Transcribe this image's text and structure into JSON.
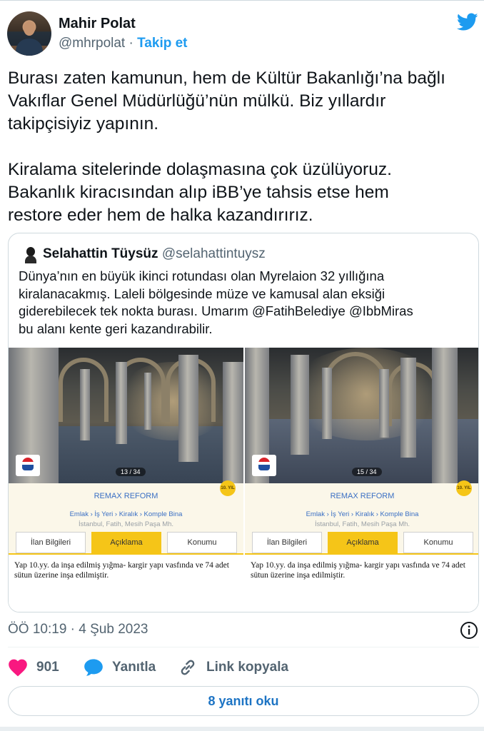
{
  "author": {
    "name": "Mahir Polat",
    "handle": "@mhrpolat",
    "separator": "·",
    "follow_label": "Takip et"
  },
  "tweet": {
    "paragraph1": [
      "Burası zaten kamunun, hem de Kültür Bakanlığı’na bağlı",
      "Vakıflar Genel Müdürlüğü’nün mülkü. Biz yıllardır",
      "takipçisiyiz yapının."
    ],
    "paragraph2": [
      "Kiralama sitelerinde dolaşmasına çok üzülüyoruz.",
      "Bakanlık kiracısından alıp iBB’ye tahsis etse hem",
      "restore eder hem de halka kazandırırız."
    ]
  },
  "quoted": {
    "name": "Selahattin Tüysüz",
    "handle": "@selahattintuysz",
    "text": [
      "Dünya’nın en büyük ikinci rotundası olan Myrelaion 32 yıllığına",
      "kiralanacakmış. Laleli bölgesinde müze ve kamusal alan eksiği",
      "giderebilecek tek nokta burası. Umarım @FatihBelediye @IbbMiras",
      " bu alanı kente geri kazandırabilir."
    ],
    "photos": [
      {
        "counter": "13 / 34",
        "agency": "REMAX REFORM",
        "badge": "10. YIL",
        "breadcrumb": "Emlak › İş Yeri › Kiralık › Komple Bina",
        "location": "İstanbul, Fatih, Mesih Paşa Mh.",
        "tabs": [
          "İlan Bilgileri",
          "Açıklama",
          "Konumu"
        ],
        "description": "Yap 10.yy. da inşa edilmiş yığma- kargir yapı vasfında ve 74 adet sütun üzerine inşa edilmiştir."
      },
      {
        "counter": "15 / 34",
        "agency": "REMAX REFORM",
        "badge": "10. YIL",
        "breadcrumb": "Emlak › İş Yeri › Kiralık › Komple Bina",
        "location": "İstanbul, Fatih, Mesih Paşa Mh.",
        "tabs": [
          "İlan Bilgileri",
          "Açıklama",
          "Konumu"
        ],
        "description": "Yap 10.yy. da inşa edilmiş yığma- kargir yapı vasfında ve 74 adet sütun üzerine inşa edilmiştir."
      }
    ]
  },
  "meta": {
    "timestamp": "ÖÖ 10:19 · 4 Şub 2023"
  },
  "actions": {
    "likes": "901",
    "reply_label": "Yanıtla",
    "copy_label": "Link kopyala",
    "read_replies_label": "8 yanıtı oku"
  },
  "colors": {
    "accent": "#1d9bf0",
    "like": "#f91880",
    "reply": "#1d9bf0",
    "listing_yellow": "#f5c518"
  },
  "icons": {
    "platform": "twitter-bird-icon",
    "info": "info-icon",
    "like": "heart-icon",
    "reply": "speech-bubble-icon",
    "copy": "link-icon"
  }
}
